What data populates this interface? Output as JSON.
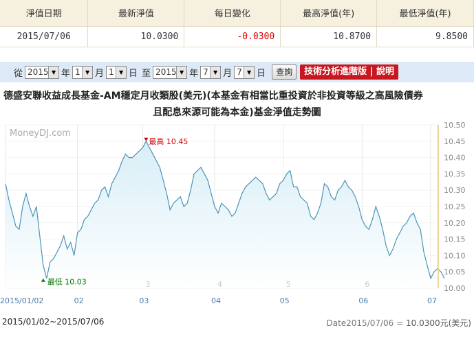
{
  "summary": {
    "headers": [
      "淨值日期",
      "最新淨值",
      "每日變化",
      "最高淨值(年)",
      "最低淨值(年)"
    ],
    "row": {
      "date": "2015/07/06",
      "nav": "10.0300",
      "change": "-0.0300",
      "high": "10.8700",
      "low": "9.8500"
    }
  },
  "query": {
    "from_label": "從",
    "to_label": "至",
    "year_unit": "年",
    "month_unit": "月",
    "day_unit": "日",
    "start": {
      "year": "2015",
      "month": "1",
      "day": "1"
    },
    "end": {
      "year": "2015",
      "month": "7",
      "day": "7"
    },
    "query_button": "查詢",
    "advanced_button": "技術分析進階版",
    "help_button": "說明"
  },
  "title_line1": "德盛安聯收益成長基金-AM穩定月收類股(美元)(本基金有相當比重投資於非投資等級之高風險債券",
  "title_line2": "且配息來源可能為本金)基金淨值走勢圖",
  "watermark": "MoneyDJ.com",
  "footer": {
    "range": "2015/01/02~2015/07/06",
    "date_label": "Date2015/07/06 = ",
    "value": "10.0300元(美元)"
  },
  "colors": {
    "line": "#4a94b6",
    "fill": "#d8eef7",
    "high": "#cc0000",
    "low": "#007a00"
  },
  "chart_data": {
    "type": "area",
    "ylim": [
      10.0,
      10.5
    ],
    "yticks": [
      "10.50",
      "10.45",
      "10.40",
      "10.35",
      "10.30",
      "10.25",
      "10.20",
      "10.15",
      "10.10",
      "10.05",
      "10.00"
    ],
    "xticks": [
      "2015/01/02",
      "02",
      "03",
      "04",
      "05",
      "06",
      "07"
    ],
    "xtick_pos": [
      0,
      21,
      40,
      61,
      81,
      104,
      124
    ],
    "n_points": 127,
    "high_label": "最高",
    "high_value": "10.45",
    "high_index": 41,
    "low_label": "最低",
    "low_value": "10.03",
    "low_index": 11,
    "values": [
      10.32,
      10.27,
      10.23,
      10.19,
      10.18,
      10.25,
      10.29,
      10.25,
      10.22,
      10.25,
      10.16,
      10.07,
      10.03,
      10.08,
      10.09,
      10.11,
      10.13,
      10.16,
      10.12,
      10.14,
      10.1,
      10.17,
      10.18,
      10.21,
      10.22,
      10.24,
      10.26,
      10.27,
      10.3,
      10.31,
      10.28,
      10.32,
      10.34,
      10.36,
      10.39,
      10.41,
      10.4,
      10.4,
      10.41,
      10.42,
      10.43,
      10.45,
      10.43,
      10.41,
      10.39,
      10.37,
      10.33,
      10.29,
      10.24,
      10.26,
      10.27,
      10.28,
      10.25,
      10.26,
      10.3,
      10.35,
      10.36,
      10.37,
      10.35,
      10.33,
      10.29,
      10.25,
      10.23,
      10.26,
      10.25,
      10.24,
      10.22,
      10.23,
      10.26,
      10.29,
      10.31,
      10.32,
      10.33,
      10.34,
      10.33,
      10.32,
      10.29,
      10.27,
      10.28,
      10.29,
      10.32,
      10.33,
      10.35,
      10.36,
      10.31,
      10.31,
      10.28,
      10.27,
      10.26,
      10.22,
      10.21,
      10.23,
      10.26,
      10.32,
      10.31,
      10.28,
      10.27,
      10.3,
      10.31,
      10.33,
      10.31,
      10.3,
      10.28,
      10.25,
      10.21,
      10.19,
      10.18,
      10.21,
      10.25,
      10.22,
      10.18,
      10.13,
      10.1,
      10.12,
      10.15,
      10.17,
      10.19,
      10.2,
      10.22,
      10.23,
      10.2,
      10.18,
      10.11,
      10.07,
      10.03,
      10.05,
      10.06,
      10.05,
      10.03
    ]
  }
}
